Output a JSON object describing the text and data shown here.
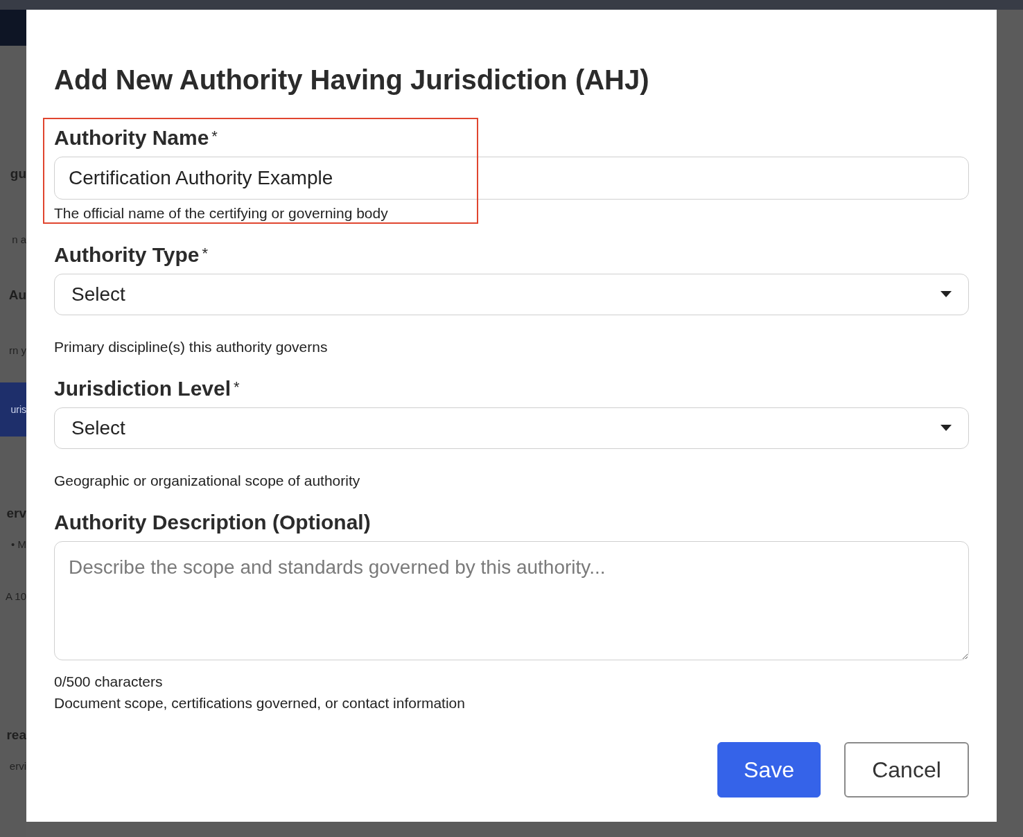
{
  "background": {
    "fragments": [
      {
        "text": "gu",
        "kind": "heading"
      },
      {
        "text": "n a",
        "kind": "text"
      },
      {
        "text": "Au",
        "kind": "heading"
      },
      {
        "text": "rn y",
        "kind": "text"
      },
      {
        "text": "uris",
        "kind": "button"
      },
      {
        "text": "erv",
        "kind": "heading"
      },
      {
        "text": "•  M",
        "kind": "meta"
      },
      {
        "text": "A 10",
        "kind": "text"
      },
      {
        "text": "rea",
        "kind": "heading"
      },
      {
        "text": "ervi",
        "kind": "meta"
      }
    ]
  },
  "dialog": {
    "title": "Add New Authority Having Jurisdiction (AHJ)",
    "fields": [
      {
        "kind": "text",
        "label": "Authority Name",
        "required_mark": "*",
        "value": "Certification Authority Example",
        "help": "The official name of the certifying or governing body",
        "highlighted": true
      },
      {
        "kind": "select",
        "label": "Authority Type",
        "required_mark": "*",
        "value": "Select",
        "help": "Primary discipline(s) this authority governs",
        "highlighted": false
      },
      {
        "kind": "select",
        "label": "Jurisdiction Level",
        "required_mark": "*",
        "value": "Select",
        "help": "Geographic or organizational scope of authority",
        "highlighted": false
      },
      {
        "kind": "textarea",
        "label": "Authority Description (Optional)",
        "placeholder": "Describe the scope and standards governed by this authority...",
        "counter": "0/500 characters",
        "help": "Document scope, certifications governed, or contact information",
        "highlighted": false
      }
    ],
    "buttons": [
      {
        "label": "Save",
        "kind": "primary"
      },
      {
        "label": "Cancel",
        "kind": "secondary"
      }
    ]
  }
}
